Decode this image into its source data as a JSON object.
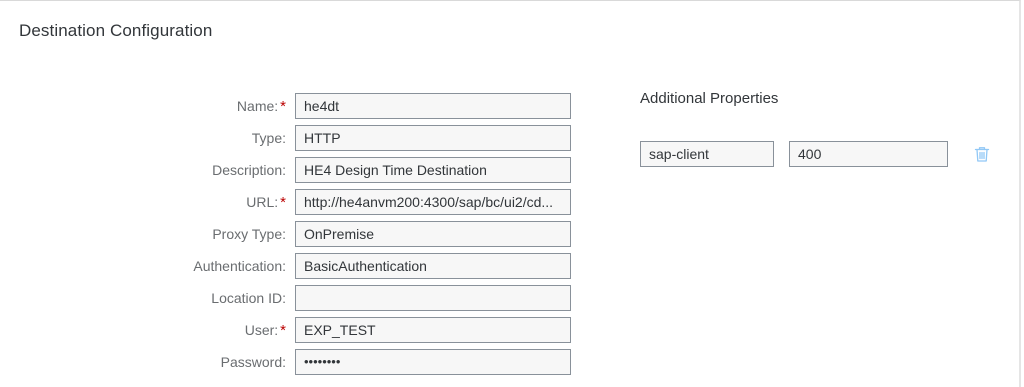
{
  "title": "Destination Configuration",
  "form": {
    "fields": [
      {
        "label": "Name:",
        "required": true,
        "value": "he4dt"
      },
      {
        "label": "Type:",
        "required": false,
        "value": "HTTP"
      },
      {
        "label": "Description:",
        "required": false,
        "value": "HE4 Design Time Destination"
      },
      {
        "label": "URL:",
        "required": true,
        "value": "http://he4anvm200:4300/sap/bc/ui2/cd..."
      },
      {
        "label": "Proxy Type:",
        "required": false,
        "value": "OnPremise"
      },
      {
        "label": "Authentication:",
        "required": false,
        "value": "BasicAuthentication"
      },
      {
        "label": "Location ID:",
        "required": false,
        "value": ""
      },
      {
        "label": "User:",
        "required": true,
        "value": "EXP_TEST"
      },
      {
        "label": "Password:",
        "required": false,
        "value": "••••••••"
      }
    ],
    "required_marker": "*"
  },
  "additional": {
    "title": "Additional Properties",
    "properties": [
      {
        "key": "sap-client",
        "value": "400",
        "delete_icon": "trash-icon"
      }
    ]
  },
  "colors": {
    "required": "#bb0000",
    "icon": "#91c8f6"
  }
}
